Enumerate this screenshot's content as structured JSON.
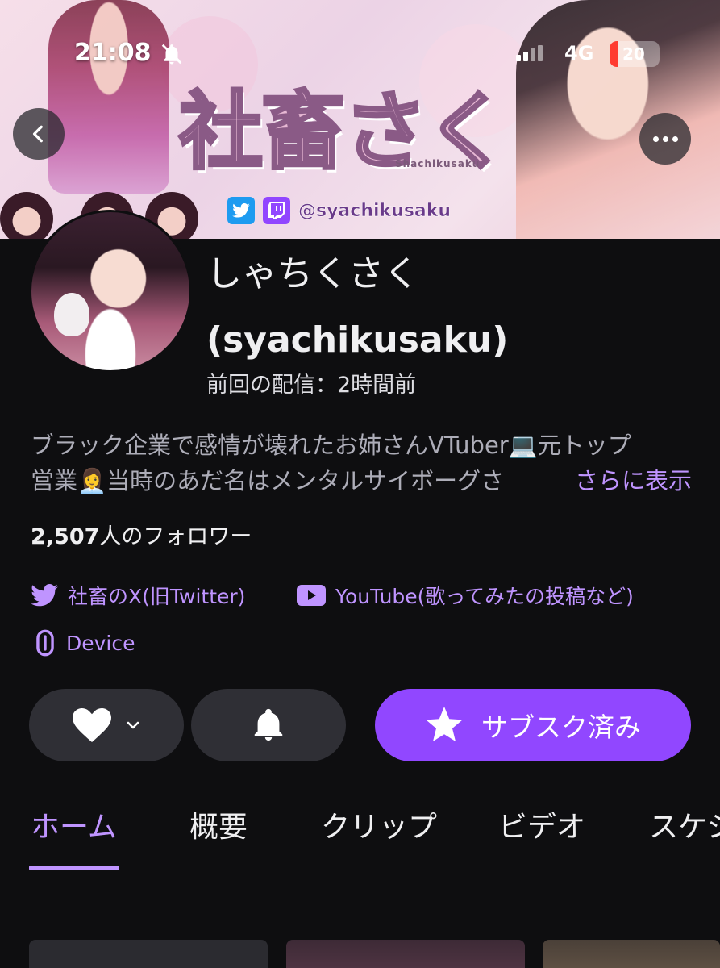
{
  "status_bar": {
    "time": "21:08",
    "network": "4G",
    "battery": "20"
  },
  "banner": {
    "logo_text": "社畜さく",
    "logo_sub": "Shachikusaku",
    "handle": "@syachikusaku"
  },
  "channel": {
    "display_name": "しゃちくさく",
    "login": "(syachikusaku)",
    "last_stream": "前回の配信：2時間前"
  },
  "bio": {
    "line1": "ブラック企業で感情が壊れたお姉さんVTuber💻元トップ",
    "line2": "営業👩‍💼当時のあだ名はメンタルサイボーグさ",
    "more_label": "さらに表示"
  },
  "followers": {
    "count": "2,507",
    "suffix": "人のフォロワー"
  },
  "links": [
    {
      "label": "社畜のX(旧Twitter)",
      "icon": "twitter-icon"
    },
    {
      "label": "YouTube(歌ってみたの投稿など)",
      "icon": "youtube-icon"
    },
    {
      "label": "Device",
      "icon": "link-icon"
    }
  ],
  "actions": {
    "subscribe_label": "サブスク済み"
  },
  "tabs": [
    {
      "label": "ホーム",
      "active": true
    },
    {
      "label": "概要"
    },
    {
      "label": "クリップ"
    },
    {
      "label": "ビデオ"
    },
    {
      "label": "スケジュール"
    }
  ],
  "colors": {
    "accent": "#bf94ff",
    "subscribe": "#9147ff",
    "background": "#0e0e10",
    "button": "#2f2f35"
  }
}
